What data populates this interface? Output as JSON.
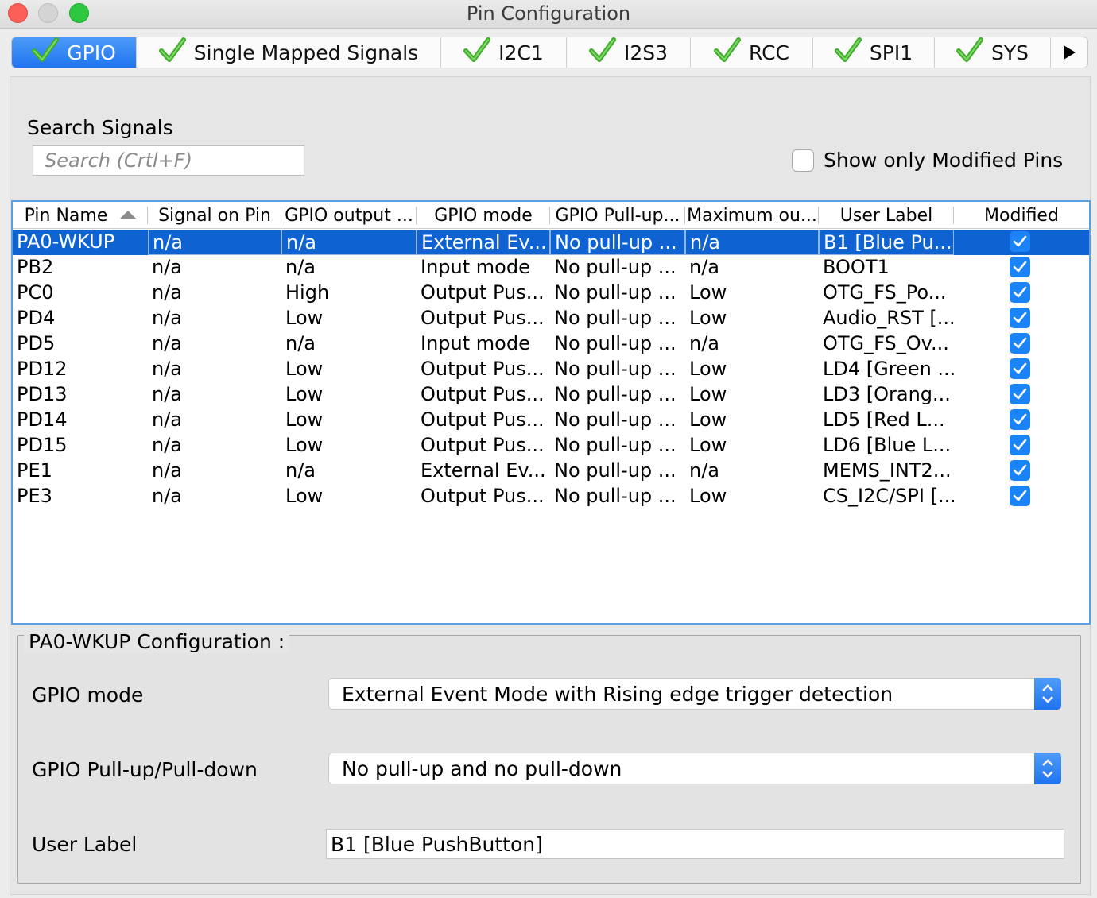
{
  "window": {
    "title": "Pin Configuration"
  },
  "tabs": [
    {
      "label": "GPIO",
      "active": true
    },
    {
      "label": "Single Mapped Signals"
    },
    {
      "label": "I2C1"
    },
    {
      "label": "I2S3"
    },
    {
      "label": "RCC"
    },
    {
      "label": "SPI1"
    },
    {
      "label": "SYS"
    }
  ],
  "search": {
    "label": "Search Signals",
    "placeholder": "Search (Crtl+F)"
  },
  "show_modified": {
    "label": "Show only Modified Pins",
    "checked": false
  },
  "table": {
    "columns": [
      "Pin Name",
      "Signal on Pin",
      "GPIO output ...",
      "GPIO mode",
      "GPIO Pull-up...",
      "Maximum ou...",
      "User Label",
      "Modified"
    ],
    "sorted_by": "Pin Name",
    "rows": [
      [
        "PA0-WKUP",
        "n/a",
        "n/a",
        "External Ev...",
        "No pull-up ...",
        "n/a",
        "B1 [Blue Pu...",
        true
      ],
      [
        "PB2",
        "n/a",
        "n/a",
        "Input mode",
        "No pull-up ...",
        "n/a",
        "BOOT1",
        true
      ],
      [
        "PC0",
        "n/a",
        "High",
        "Output Pus...",
        "No pull-up ...",
        "Low",
        "OTG_FS_Po...",
        true
      ],
      [
        "PD4",
        "n/a",
        "Low",
        "Output Pus...",
        "No pull-up ...",
        "Low",
        "Audio_RST [...",
        true
      ],
      [
        "PD5",
        "n/a",
        "n/a",
        "Input mode",
        "No pull-up ...",
        "n/a",
        "OTG_FS_Ov...",
        true
      ],
      [
        "PD12",
        "n/a",
        "Low",
        "Output Pus...",
        "No pull-up ...",
        "Low",
        "LD4 [Green ...",
        true
      ],
      [
        "PD13",
        "n/a",
        "Low",
        "Output Pus...",
        "No pull-up ...",
        "Low",
        "LD3 [Orang...",
        true
      ],
      [
        "PD14",
        "n/a",
        "Low",
        "Output Pus...",
        "No pull-up ...",
        "Low",
        "LD5 [Red L...",
        true
      ],
      [
        "PD15",
        "n/a",
        "Low",
        "Output Pus...",
        "No pull-up ...",
        "Low",
        "LD6 [Blue L...",
        true
      ],
      [
        "PE1",
        "n/a",
        "n/a",
        "External Ev...",
        "No pull-up ...",
        "n/a",
        "MEMS_INT2...",
        true
      ],
      [
        "PE3",
        "n/a",
        "Low",
        "Output Pus...",
        "No pull-up ...",
        "Low",
        "CS_I2C/SPI [...",
        true
      ]
    ],
    "selected_row": 0
  },
  "config": {
    "title": "PA0-WKUP Configuration :",
    "gpio_mode_label": "GPIO mode",
    "gpio_mode_value": "External Event Mode with Rising edge trigger detection",
    "pull_label": "GPIO Pull-up/Pull-down",
    "pull_value": "No pull-up and no pull-down",
    "user_label_label": "User Label",
    "user_label_value": "B1 [Blue PushButton]"
  },
  "colors": {
    "accent": "#0e62d1",
    "check_green": "#3fae2a",
    "tab_active": "#2075ef"
  },
  "icons": {
    "tab_check": "green-checkmark-icon",
    "more_tabs": "triangle-right-icon",
    "select_stepper": "up-down-chevron-icon"
  }
}
